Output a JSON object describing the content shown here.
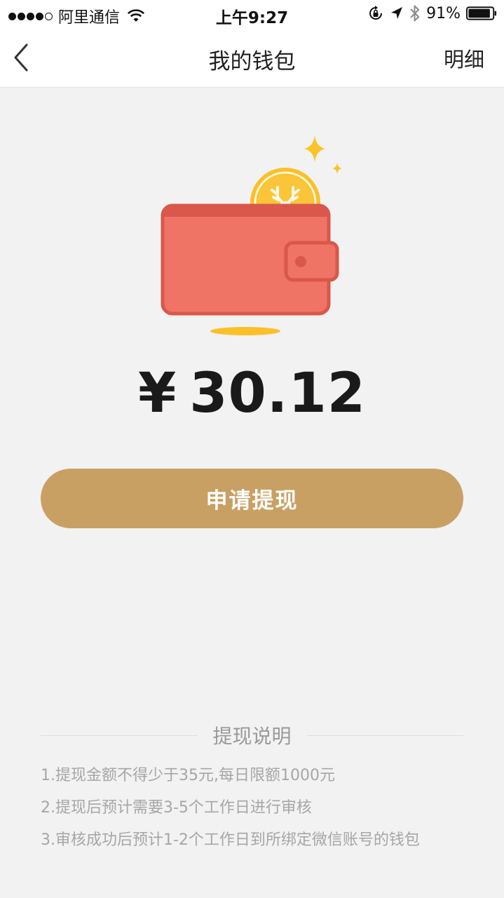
{
  "status_bar": {
    "carrier": "阿里通信",
    "time": "上午9:27",
    "battery": "91%",
    "battery_level": 0.91,
    "signal_bars_filled": 4,
    "signal_bars_total": 5
  },
  "nav": {
    "title": "我的钱包",
    "detail_label": "明细"
  },
  "wallet": {
    "currency_symbol": "¥",
    "balance": "30.12"
  },
  "withdraw_button_label": "申请提现",
  "instructions": {
    "title": "提现说明",
    "rules": [
      "1.提现金额不得少于35元,每日限额1000元",
      "2.提现后预计需要3-5个工作日进行审核",
      "3.审核成功后预计1-2个工作日到所绑定微信账号的钱包"
    ]
  },
  "colors": {
    "accent": "#c9a063",
    "wallet_body": "#f07466",
    "wallet_border": "#d9574b",
    "coin": "#fbbf2a",
    "background": "#f2f2f2"
  },
  "icons": {
    "back": "chevron-left-icon",
    "wifi": "wifi-icon",
    "rotation_lock": "rotation-lock-icon",
    "location": "location-arrow-icon",
    "bluetooth": "bluetooth-icon",
    "battery": "battery-icon"
  }
}
